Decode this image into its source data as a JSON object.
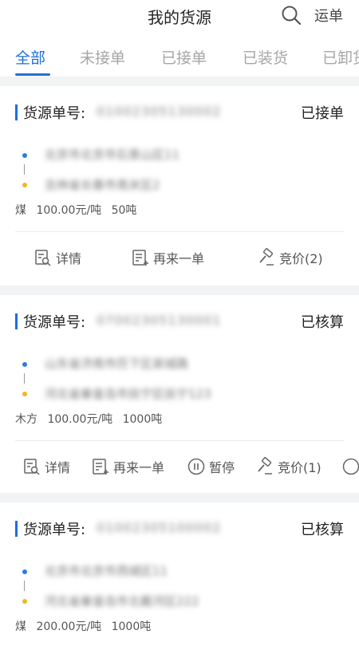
{
  "header": {
    "title": "我的货源",
    "search_icon": "search-icon",
    "waybill_label": "运单"
  },
  "tabs": [
    {
      "label": "全部",
      "active": true
    },
    {
      "label": "未接单",
      "active": false
    },
    {
      "label": "已接单",
      "active": false
    },
    {
      "label": "已装货",
      "active": false
    },
    {
      "label": "已卸货",
      "active": false
    }
  ],
  "colors": {
    "accent": "#1f6fd6",
    "start_dot": "#2e7be0",
    "end_dot": "#f3b61a"
  },
  "cards": [
    {
      "label": "货源单号:",
      "order_no": "01002305130002",
      "status": "已接单",
      "from": "北京市北京市石景山区11",
      "to": "吉林省长春市南关区2",
      "cargo": "煤",
      "price": "100.00元/吨",
      "weight": "50吨",
      "actions": [
        {
          "icon": "details-icon",
          "label": "详情"
        },
        {
          "icon": "reorder-icon",
          "label": "再来一单"
        },
        {
          "icon": "auction-icon",
          "label": "竞价(2)"
        }
      ]
    },
    {
      "label": "货源单号:",
      "order_no": "07002305130001",
      "status": "已核算",
      "from": "山东省济南市历下区泉城路",
      "to": "河北省秦皇岛市抚宁区抚宁123",
      "cargo": "木方",
      "price": "100.00元/吨",
      "weight": "1000吨",
      "actions": [
        {
          "icon": "details-icon",
          "label": "详情"
        },
        {
          "icon": "reorder-icon",
          "label": "再来一单"
        },
        {
          "icon": "pause-icon",
          "label": "暂停"
        },
        {
          "icon": "auction-icon",
          "label": "竞价(1)"
        }
      ]
    },
    {
      "label": "货源单号:",
      "order_no": "01002305100002",
      "status": "已核算",
      "from": "北京市北京市西城区11",
      "to": "河北省秦皇岛市北戴河区222",
      "cargo": "煤",
      "price": "200.00元/吨",
      "weight": "1000吨",
      "actions": []
    }
  ]
}
